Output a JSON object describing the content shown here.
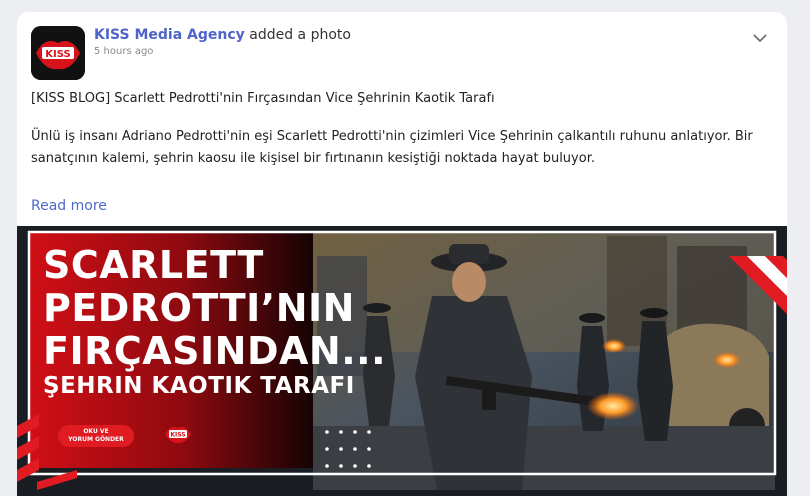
{
  "post": {
    "author": "KISS Media Agency",
    "action": "added a photo",
    "time": "5 hours ago",
    "title": "[KISS BLOG] Scarlett Pedrotti'nin Fırçasından Vice Şehrinin Kaotik Tarafı",
    "body": "Ünlü iş insanı Adriano Pedrotti'nin eşi Scarlett Pedrotti'nin çizimleri Vice Şehrinin çalkantılı ruhunu anlatıyor. Bir sanatçının kalemi, şehrin kaosu ile kişisel bir fırtınanın kesiştiği noktada hayat buluyor.",
    "read_more": "Read more"
  },
  "avatar": {
    "logo_text": "KISS"
  },
  "banner": {
    "line1": "SCARLETT",
    "line2": "PEDROTTI’NIN",
    "line3": "FIRÇASINDAN...",
    "line4": "ŞEHRIN KAOTIK TARAFI",
    "pill_line1": "OKU VE",
    "pill_line2": "YORUM GÖNDER",
    "logo_text": "KISS"
  },
  "icons": {
    "menu": "chevron-down-icon"
  },
  "colors": {
    "accent": "#e01b22",
    "author": "#4f63c9",
    "link": "#5169c8"
  }
}
